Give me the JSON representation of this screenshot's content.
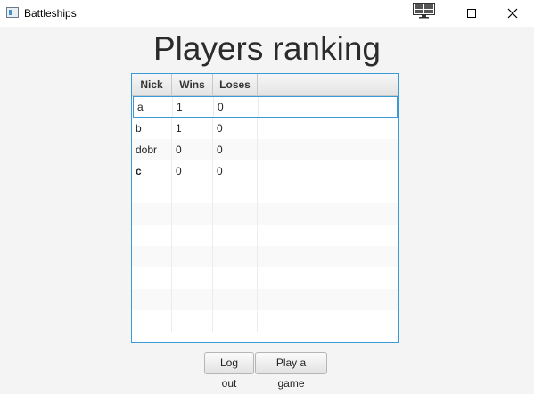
{
  "window": {
    "title": "Battleships",
    "icons": [
      "app-icon",
      "monitor-icon",
      "minimize-icon",
      "maximize-icon",
      "close-icon"
    ]
  },
  "page": {
    "title": "Players ranking"
  },
  "table": {
    "columns": [
      "Nick",
      "Wins",
      "Loses"
    ],
    "rows": [
      {
        "nick": "a",
        "wins": "1",
        "loses": "0",
        "selected": true
      },
      {
        "nick": "b",
        "wins": "1",
        "loses": "0"
      },
      {
        "nick": "dobr",
        "wins": "0",
        "loses": "0"
      },
      {
        "nick": "c",
        "wins": "0",
        "loses": "0",
        "bold": true
      }
    ],
    "empty_rows": 7
  },
  "buttons": {
    "logout": "Log out",
    "play": "Play a game"
  },
  "colors": {
    "accent": "#3a9ad6",
    "background": "#f4f4f4"
  }
}
